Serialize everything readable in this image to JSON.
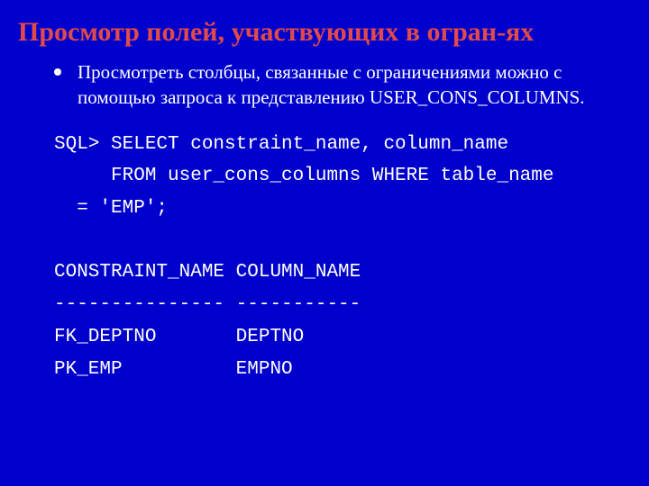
{
  "title": "Просмотр полей, участвующих в огран-ях",
  "bullet": "Просмотреть столбцы, связанные с ограничениями можно с помощью запроса к представлению USER_CONS_COLUMNS.",
  "code": {
    "l1": "SQL> SELECT constraint_name, column_name",
    "l2": "     FROM user_cons_columns WHERE table_name",
    "l3": "  = 'EMP';",
    "l4": "",
    "l5": "CONSTRAINT_NAME COLUMN_NAME",
    "l6": "--------------- -----------",
    "l7": "FK_DEPTNO       DEPTNO",
    "l8": "PK_EMP          EMPNO"
  }
}
